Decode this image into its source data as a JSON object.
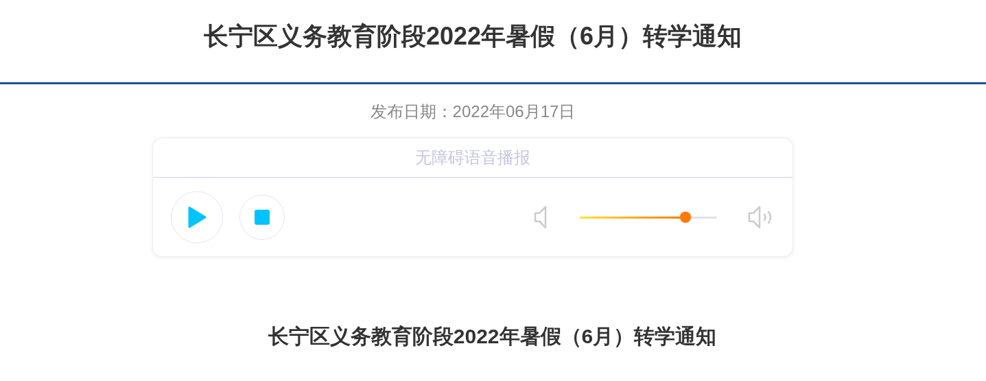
{
  "title": "长宁区义务教育阶段2022年暑假（6月）转学通知",
  "publish_date": "发布日期：2022年06月17日",
  "player": {
    "label": "无障碍语音播报",
    "volume": {
      "level": 0.77
    }
  },
  "article_heading": "长宁区义务教育阶段2022年暑假（6月）转学通知"
}
